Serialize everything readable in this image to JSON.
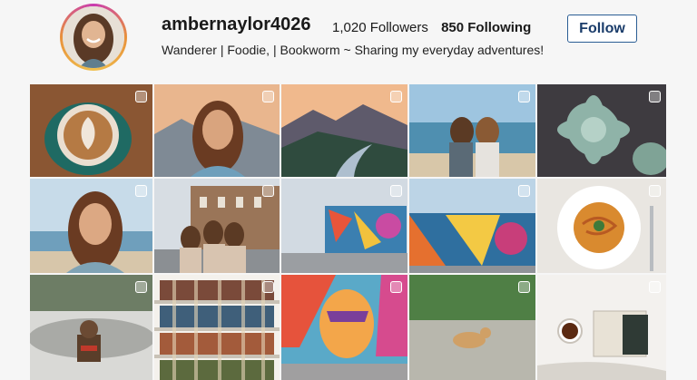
{
  "profile": {
    "username": "ambernaylor4026",
    "followers": "1,020 Followers",
    "following": "850 Following",
    "bio": "Wanderer | Foodie, | Bookworm ~ Sharing my everyday adventures!",
    "follow_label": "Follow"
  },
  "colors": {
    "button_border": "#2a5d94",
    "avatar_ring": "#c93bb0"
  }
}
